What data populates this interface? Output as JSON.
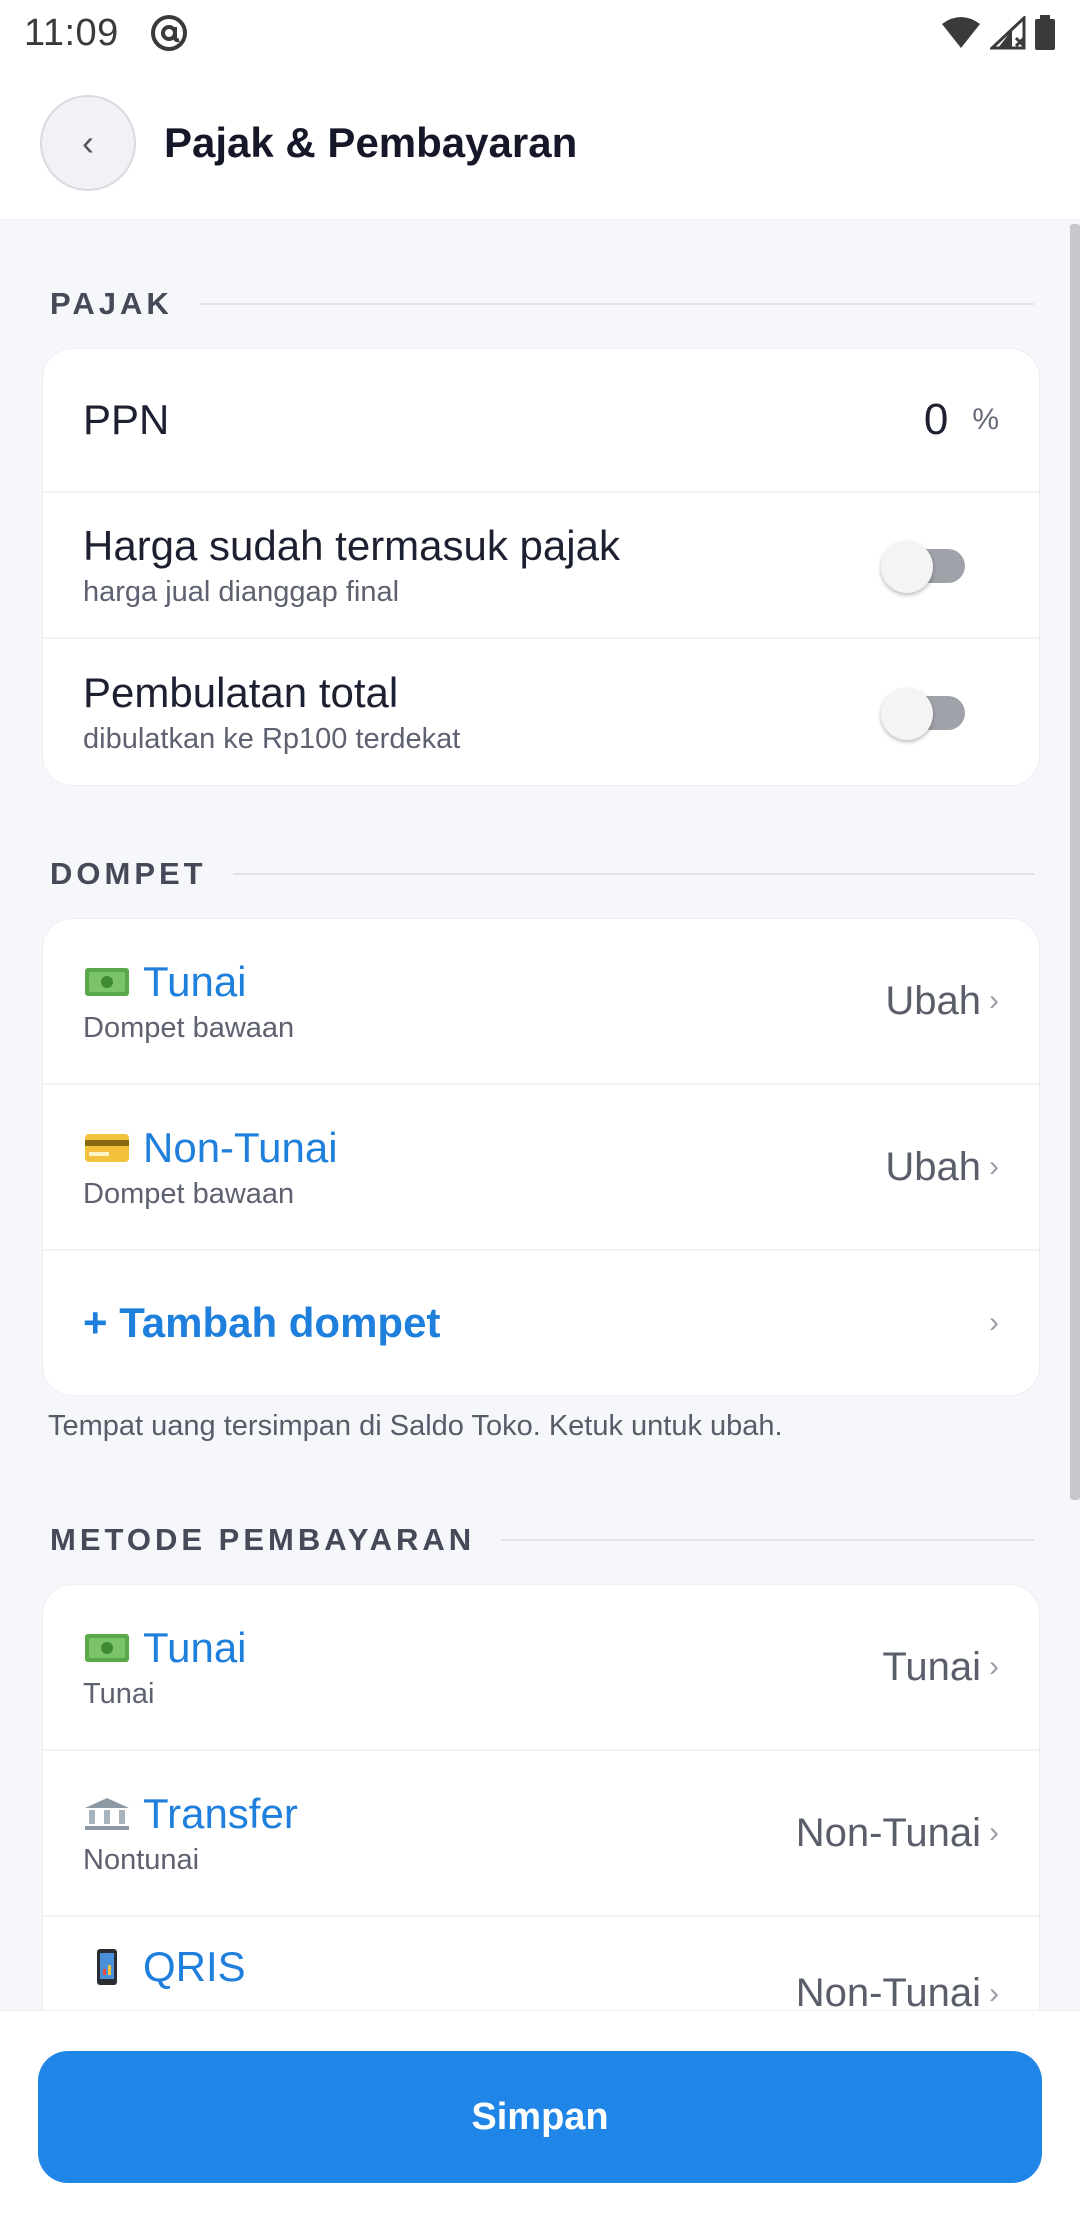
{
  "status": {
    "time": "11:09",
    "icons": [
      "at-icon",
      "wifi-icon",
      "signal-icon",
      "battery-icon"
    ]
  },
  "header": {
    "title": "Pajak & Pembayaran",
    "back_glyph": "‹"
  },
  "pajak": {
    "label": "PAJAK",
    "ppn": {
      "label": "PPN",
      "value": "0",
      "unit": "%"
    },
    "inclusive": {
      "title": "Harga sudah termasuk pajak",
      "sub": "harga jual dianggap final",
      "enabled": false
    },
    "rounding": {
      "title": "Pembulatan total",
      "sub": "dibulatkan ke Rp100 terdekat",
      "enabled": false
    }
  },
  "dompet": {
    "label": "DOMPET",
    "items": [
      {
        "icon": "cash-icon",
        "title": "Tunai",
        "sub": "Dompet bawaan",
        "action": "Ubah"
      },
      {
        "icon": "card-icon",
        "title": "Non-Tunai",
        "sub": "Dompet bawaan",
        "action": "Ubah"
      }
    ],
    "add_label": "+ Tambah dompet",
    "hint": "Tempat uang tersimpan di Saldo Toko. Ketuk untuk ubah."
  },
  "metode": {
    "label": "METODE PEMBAYARAN",
    "items": [
      {
        "icon": "cash-icon",
        "title": "Tunai",
        "sub": "Tunai",
        "wallet": "Tunai"
      },
      {
        "icon": "bank-icon",
        "title": "Transfer",
        "sub": "Nontunai",
        "wallet": "Non-Tunai"
      },
      {
        "icon": "phone-icon",
        "title": "QRIS",
        "sub": "",
        "wallet": "Non-Tunai"
      }
    ]
  },
  "footer": {
    "save_label": "Simpan"
  },
  "colors": {
    "accent": "#1f86e8",
    "link": "#1e7fdc",
    "background": "#f6f7fa"
  }
}
